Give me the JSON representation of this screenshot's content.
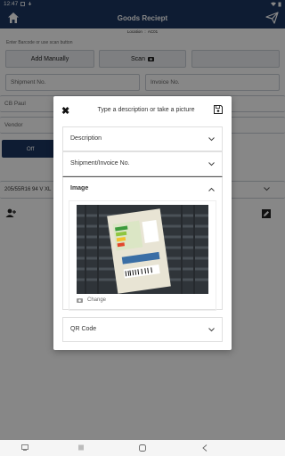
{
  "status": {
    "time": "12:47"
  },
  "header": {
    "title": "Goods Reciept"
  },
  "location": {
    "label": "Location",
    "value": "AC01"
  },
  "scan_hint": "Enter Barcode or use scan button",
  "buttons": {
    "add_manually": "Add Manually",
    "scan": "Scan"
  },
  "fields": {
    "shipment_no": "Shipment No.",
    "invoice_no": "Invoice No.",
    "customer": "CB Paul",
    "vendor": "Vendor"
  },
  "toggle": {
    "off_label": "Off"
  },
  "item": {
    "description": "205/55R16 94 V XL"
  },
  "modal": {
    "title": "Type a description or take a picture",
    "sections": {
      "description": "Description",
      "shipment_invoice": "Shipment/Invoice No.",
      "image": "Image",
      "qr_code": "QR Code"
    },
    "change_label": "Change"
  },
  "colors": {
    "primary": "#1b3560",
    "overlay": "rgba(0,0,0,0.47)"
  }
}
